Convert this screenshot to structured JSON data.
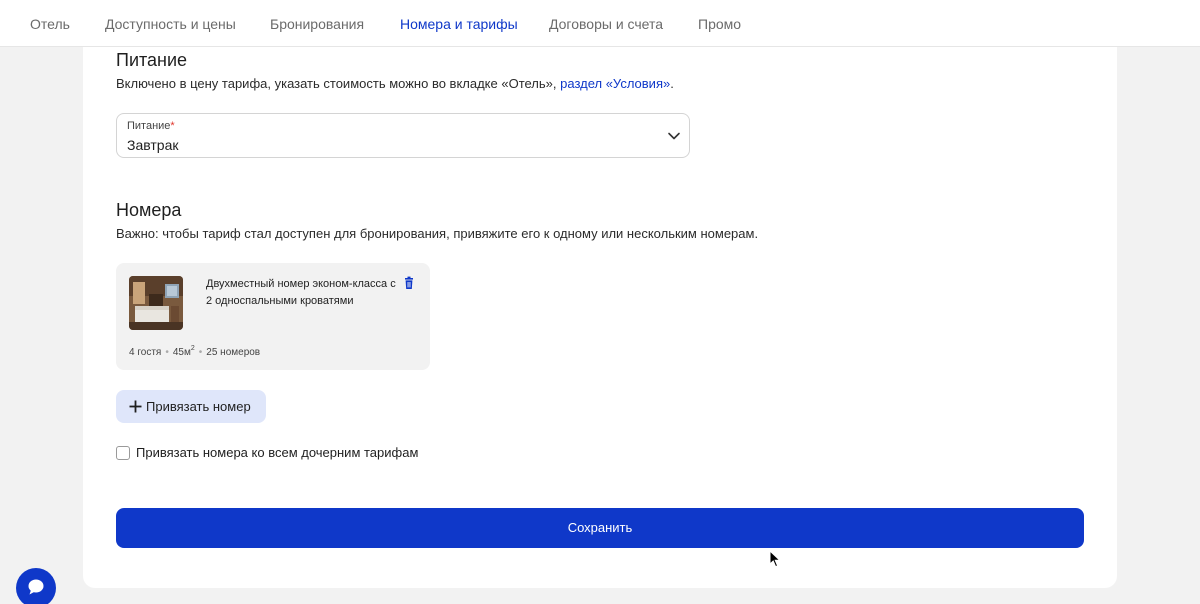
{
  "nav": {
    "tabs": [
      {
        "label": "Отель"
      },
      {
        "label": "Доступность и цены"
      },
      {
        "label": "Бронирования"
      },
      {
        "label": "Номера и тарифы"
      },
      {
        "label": "Договоры и счета"
      },
      {
        "label": "Промо"
      }
    ],
    "active_tab": "Номера и тарифы"
  },
  "meal": {
    "title": "Питание",
    "description_prefix": "Включено в цену тарифа, указать стоимость можно во вкладке «Отель», ",
    "description_link": "раздел «Условия»",
    "description_suffix": ".",
    "select_label": "Питание",
    "required_mark": "*",
    "select_value": "Завтрак"
  },
  "rooms": {
    "title": "Номера",
    "description": "Важно: чтобы тариф стал доступен для бронирования, привяжите его к одному или нескольким номерам.",
    "items": [
      {
        "name": "Двухместный номер эконом-класса с 2 односпальными кроватями",
        "guests": "4 гостя",
        "area": "45м",
        "area_unit_sup": "2",
        "count": "25 номеров"
      }
    ],
    "attach_button": "Привязать номер",
    "checkbox_label": "Привязать номера ко всем дочерним тарифам",
    "checkbox_checked": false
  },
  "save_button": "Сохранить",
  "colors": {
    "accent": "#0f38c9",
    "attach_bg": "#dfe6fa",
    "page_bg": "#f2f2f2",
    "required": "#e0352b"
  },
  "icons": {
    "select_chevron": "chevron-down-icon",
    "delete": "trash-icon",
    "attach": "plus-icon",
    "chat": "chat-icon"
  }
}
